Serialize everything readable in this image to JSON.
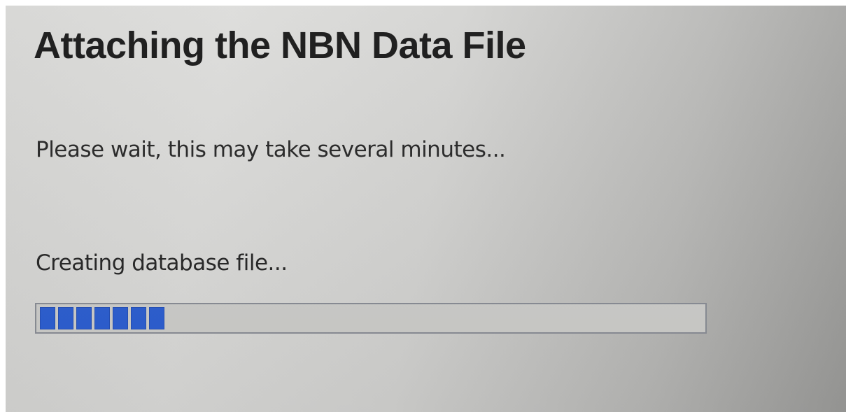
{
  "dialog": {
    "title": "Attaching the NBN Data File",
    "message": "Please wait, this may take several minutes...",
    "status": "Creating database file..."
  },
  "progress": {
    "percent": 20,
    "filled_blocks": 7,
    "color": "#2c5fd3"
  }
}
